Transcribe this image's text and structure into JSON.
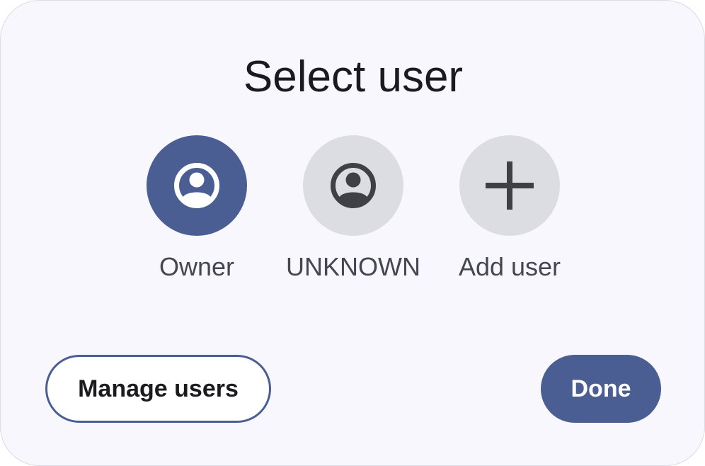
{
  "dialog": {
    "title": "Select user"
  },
  "users": [
    {
      "label": "Owner",
      "icon": "account-circle-icon",
      "selected": true
    },
    {
      "label": "UNKNOWN",
      "icon": "account-circle-icon",
      "selected": false
    },
    {
      "label": "Add user",
      "icon": "plus-icon",
      "selected": false
    }
  ],
  "buttons": {
    "manage_label": "Manage users",
    "done_label": "Done"
  },
  "colors": {
    "accent": "#4a5e94",
    "avatar_inactive": "#dcdde2",
    "icon_dark": "#3f4046",
    "dialog_bg": "#f8f7fd"
  }
}
